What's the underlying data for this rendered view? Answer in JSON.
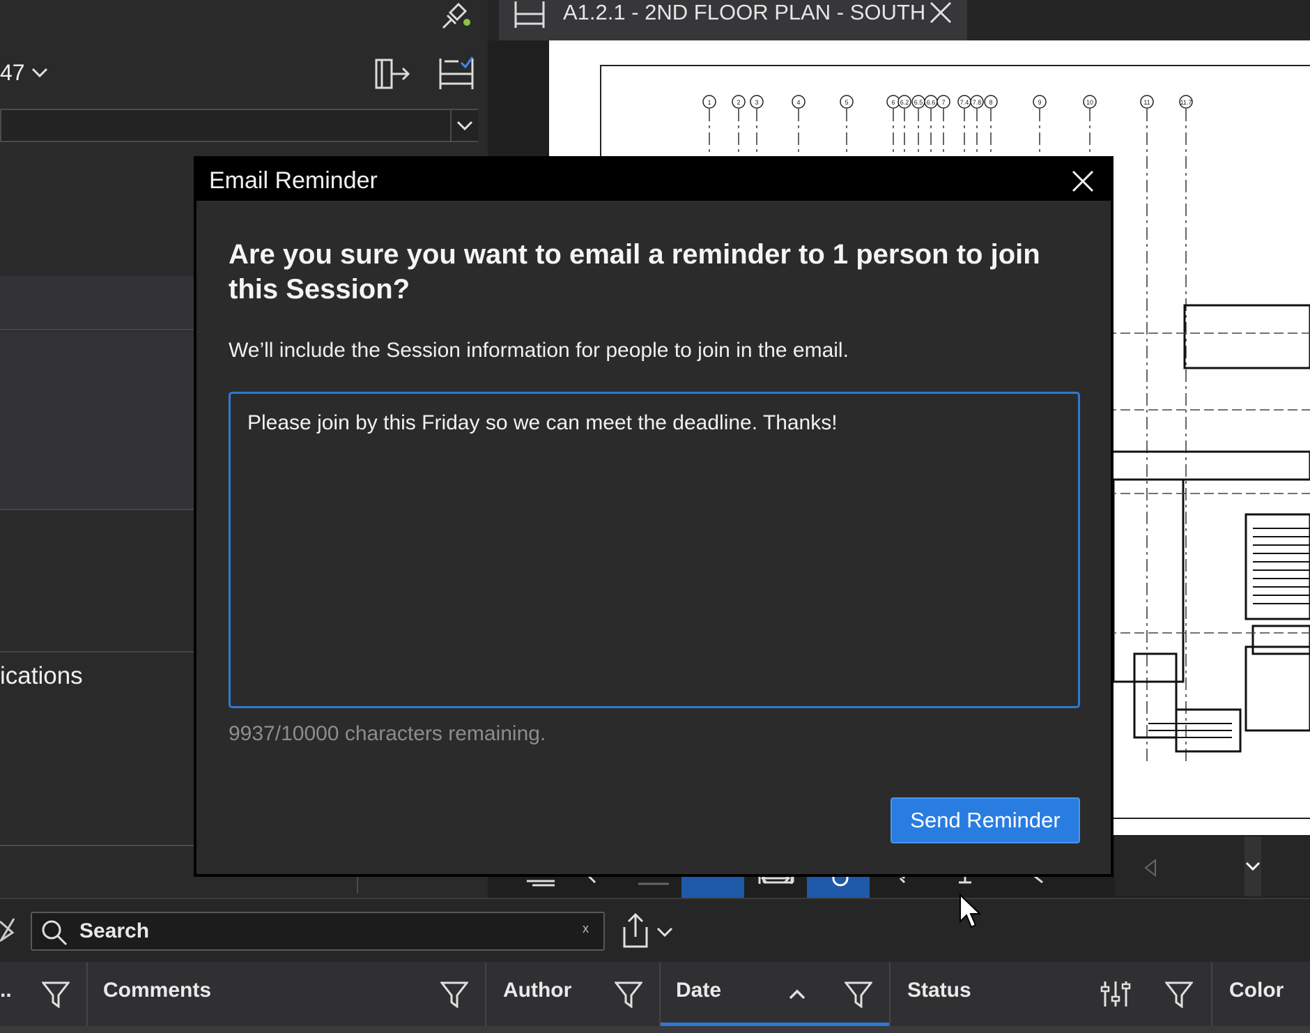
{
  "left_panel": {
    "count_label": "47",
    "partial_label": "ications"
  },
  "drawing": {
    "tab_title": "A1.2.1 - 2ND FLOOR PLAN - SOUTH",
    "grid_bubbles": [
      "1",
      "2",
      "3",
      "4",
      "5",
      "6",
      "6.2",
      "6.5",
      "6.6",
      "7",
      "7.4",
      "7.8",
      "8",
      "9",
      "10",
      "11",
      "11.7"
    ]
  },
  "dialog": {
    "title": "Email Reminder",
    "question": "Are you sure you want to email a reminder to 1 person to join this Session?",
    "info": "We’ll include the Session information for people to join in the email.",
    "message": "Please join by this Friday so we can meet the deadline. Thanks!",
    "char_count": "9937/10000 characters remaining.",
    "send_label": "Send Reminder"
  },
  "search": {
    "placeholder": "Search",
    "clear_label": "x"
  },
  "columns": {
    "first": "..",
    "comments": "Comments",
    "author": "Author",
    "date": "Date",
    "status": "Status",
    "color": "Color"
  },
  "colors": {
    "accent": "#2a7de0",
    "dialog_bg": "#2b2b2c",
    "header_bg": "#000000"
  }
}
